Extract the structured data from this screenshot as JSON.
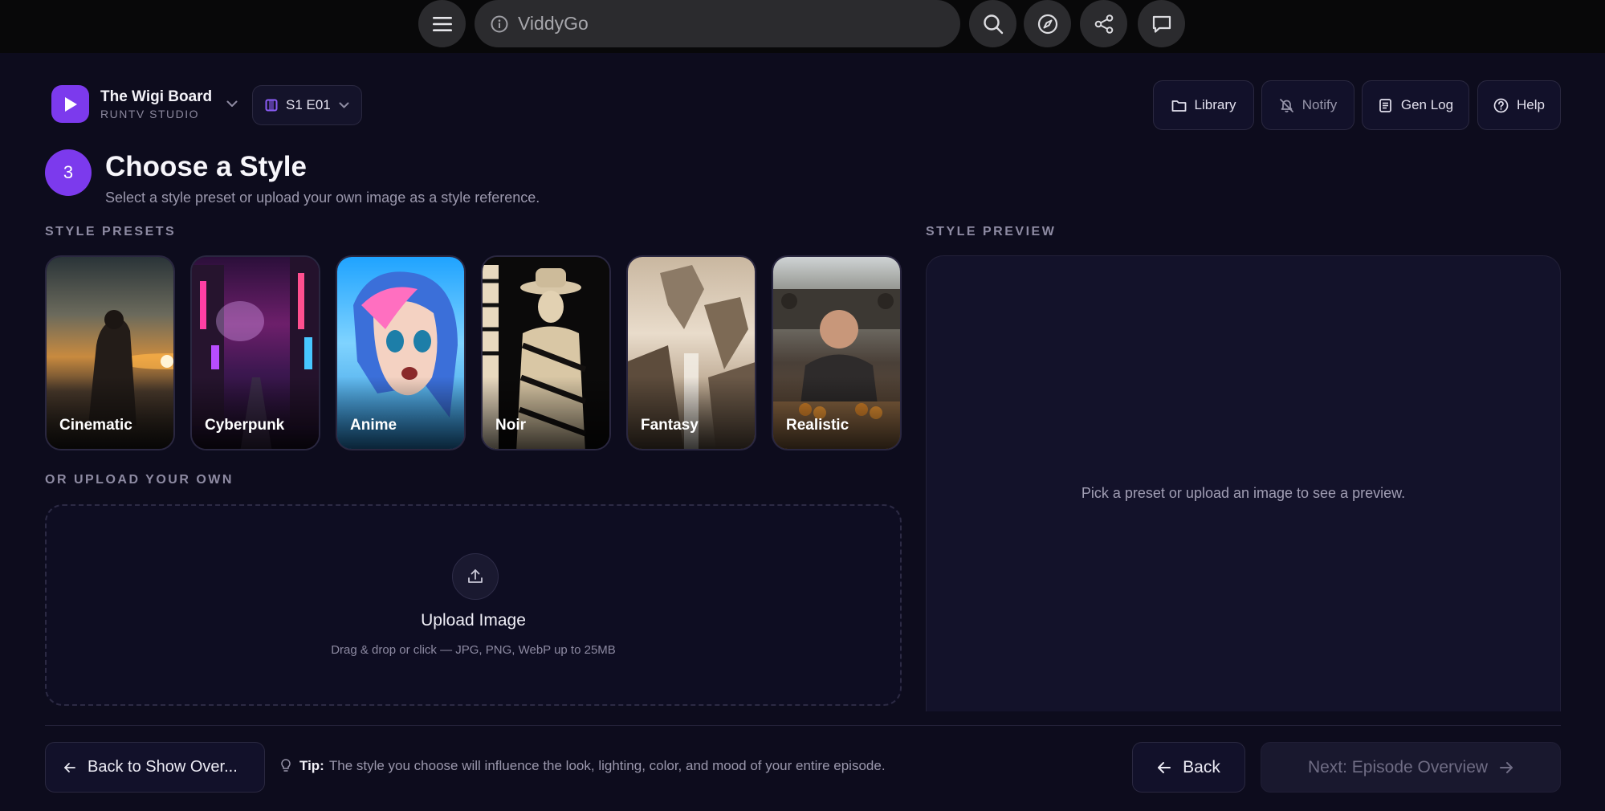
{
  "browser": {
    "url": "ViddyGo",
    "icons": [
      "menu-icon",
      "info-icon",
      "search-icon",
      "compass-icon",
      "share-icon",
      "chat-icon"
    ]
  },
  "project": {
    "name": "The Wigi Board",
    "studio": "RUNTV STUDIO"
  },
  "episode": {
    "label": "S1 E01"
  },
  "header_actions": [
    {
      "label": "Library",
      "icon": "folder-icon"
    },
    {
      "label": "Notify",
      "icon": "bell-off-icon"
    },
    {
      "label": "Gen Log",
      "icon": "log-icon"
    },
    {
      "label": "Help",
      "icon": "help-icon"
    }
  ],
  "step": {
    "number": "3",
    "title": "Choose a Style",
    "subtitle": "Select a style preset or upload your own image as a style reference."
  },
  "presets_label": "STYLE PRESETS",
  "presets": [
    {
      "label": "Cinematic"
    },
    {
      "label": "Cyberpunk"
    },
    {
      "label": "Anime"
    },
    {
      "label": "Noir"
    },
    {
      "label": "Fantasy"
    },
    {
      "label": "Realistic"
    }
  ],
  "upload": {
    "section_label": "OR UPLOAD YOUR OWN",
    "title": "Upload Image",
    "hint": "Drag & drop or click — JPG, PNG, WebP up to 25MB"
  },
  "preview": {
    "section_label": "STYLE PREVIEW",
    "empty_text": "Pick a preset or upload an image to see a preview."
  },
  "footer": {
    "back_to_show": "Back to Show Over...",
    "tip_key": "Tip:",
    "tip_text": "The style you choose will influence the look, lighting, color, and mood of your entire episode.",
    "back": "Back",
    "next": "Next: Episode Overview"
  },
  "colors": {
    "background": "#0d0c1d",
    "accent": "#7c3aed",
    "panel": "#13122a",
    "border": "#2a2840"
  }
}
